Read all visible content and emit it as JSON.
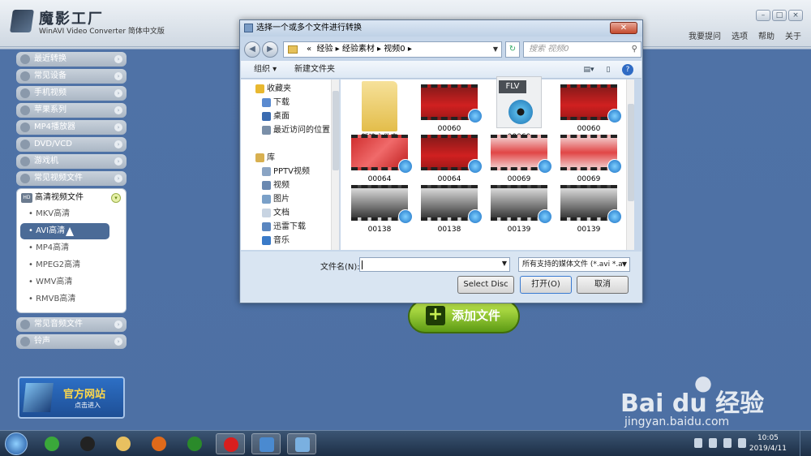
{
  "app": {
    "brand": "魔影工厂",
    "subtitle": "WinAVI Video Converter 简体中文版",
    "menu": [
      "我要提问",
      "选项",
      "帮助",
      "关于"
    ],
    "window_buttons": [
      "–",
      "□",
      "×"
    ]
  },
  "sidebar": {
    "items_top": [
      "最近转换",
      "常见设备",
      "手机视频",
      "苹果系列",
      "MP4播放器",
      "DVD/VCD",
      "游戏机",
      "常见视频文件"
    ],
    "panel_title": "高清视频文件",
    "panel_icon": "HD",
    "panel_items": [
      "MKV高清",
      "AVI高清",
      "MP4高清",
      "MPEG2高清",
      "WMV高清",
      "RMVB高清"
    ],
    "selected_item": "AVI高清",
    "items_bottom": [
      "常见音频文件",
      "铃声"
    ],
    "promo_title": "官方网站",
    "promo_sub": "点击进入"
  },
  "add_button": "添加文件",
  "dialog": {
    "title": "选择一个或多个文件进行转换",
    "close": "✕",
    "path": [
      "«",
      "经验",
      "经验素材",
      "视频0",
      "▸"
    ],
    "search_placeholder": "搜索 视频0",
    "toolbar": {
      "organize": "组织 ▾",
      "new_folder": "新建文件夹"
    },
    "nav": [
      {
        "label": "收藏夹",
        "header": true,
        "color": "#e8b830"
      },
      {
        "label": "下载",
        "header": false,
        "color": "#5a8ad0"
      },
      {
        "label": "桌面",
        "header": false,
        "color": "#3a6bb0"
      },
      {
        "label": "最近访问的位置",
        "header": false,
        "color": "#7a8fa8"
      },
      {
        "label": "",
        "header": false,
        "color": "transparent"
      },
      {
        "label": "库",
        "header": true,
        "color": "#d8b050"
      },
      {
        "label": "PPTV视频",
        "header": false,
        "color": "#8aa4c4"
      },
      {
        "label": "视频",
        "header": false,
        "color": "#6a88b0"
      },
      {
        "label": "图片",
        "header": false,
        "color": "#7aa0c8"
      },
      {
        "label": "文档",
        "header": false,
        "color": "#c8d4e2"
      },
      {
        "label": "迅雷下载",
        "header": false,
        "color": "#5a86c0"
      },
      {
        "label": "音乐",
        "header": false,
        "color": "#3a7ac8"
      }
    ],
    "files": [
      {
        "name": "新建文件夹",
        "kind": "folder"
      },
      {
        "name": "00060",
        "kind": "red"
      },
      {
        "name": "00060",
        "kind": "flv",
        "tag": "FLV"
      },
      {
        "name": "00060",
        "kind": "red"
      },
      {
        "name": "00064",
        "kind": "fw"
      },
      {
        "name": "00064",
        "kind": "red"
      },
      {
        "name": "00069",
        "kind": "fl"
      },
      {
        "name": "00069",
        "kind": "fl"
      },
      {
        "name": "00138",
        "kind": "car"
      },
      {
        "name": "00138",
        "kind": "car"
      },
      {
        "name": "00139",
        "kind": "car"
      },
      {
        "name": "00139",
        "kind": "car"
      }
    ],
    "filename_label": "文件名(N):",
    "filename_value": "",
    "filter": "所有支持的媒体文件 (*.avi *.as",
    "select_disc": "Select Disc",
    "open": "打开(O)",
    "cancel": "取消"
  },
  "taskbar": {
    "time": "10:05",
    "date": "2019/4/11",
    "apps": [
      {
        "name": "refresh-app",
        "color": "#3aa83a"
      },
      {
        "name": "qq-app",
        "color": "#222"
      },
      {
        "name": "explorer-app",
        "color": "#e8c060"
      },
      {
        "name": "firefox-app",
        "color": "#e06a1a"
      },
      {
        "name": "video-app",
        "color": "#2a8a2a"
      },
      {
        "name": "record-app",
        "color": "#d81e1e"
      },
      {
        "name": "winavi-app",
        "color": "#4a8ad0"
      },
      {
        "name": "notepad-app",
        "color": "#7ab0e0"
      }
    ]
  },
  "watermark": {
    "logo": "Bai du 经验",
    "url": "jingyan.baidu.com"
  }
}
